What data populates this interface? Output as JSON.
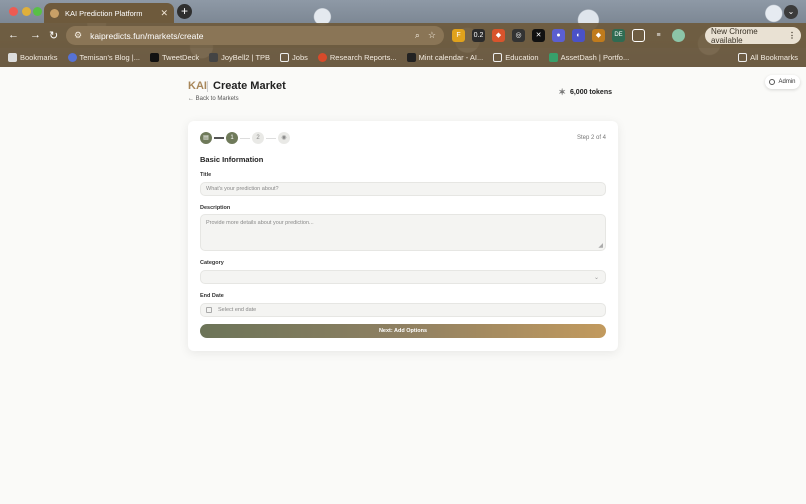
{
  "browser": {
    "tab_title": "KAI Prediction Platform",
    "url": "kaipredicts.fun/markets/create",
    "update_label": "New Chrome available",
    "bookmarks": [
      "Bookmarks",
      "Temisan's Blog |...",
      "TweetDeck",
      "JoyBell2 | TPB",
      "Jobs",
      "Research Reports...",
      "Mint calendar - AI...",
      "Education",
      "AssetDash | Portfo...",
      "All Bookmarks"
    ],
    "ext_badges": [
      "0.2",
      "DE"
    ]
  },
  "admin": {
    "label": "Admin"
  },
  "header": {
    "brand": "KAI",
    "title": "Create Market",
    "back_link": "Back to Markets",
    "tokens": "6,000 tokens"
  },
  "steps": {
    "labels": [
      "1",
      "2"
    ],
    "progress_text": "Step 2 of 4"
  },
  "form": {
    "section_title": "Basic Information",
    "title_label": "Title",
    "title_placeholder": "What's your prediction about?",
    "description_label": "Description",
    "description_placeholder": "Provide more details about your prediction...",
    "category_label": "Category",
    "category_value": "",
    "end_date_label": "End Date",
    "end_date_placeholder": "Select end date",
    "next_button": "Next: Add Options"
  },
  "colors": {
    "brand": "#a8875a",
    "step_active": "#6f7a5a",
    "button_gradient_start": "#6c7458",
    "button_gradient_end": "#c29a5e"
  }
}
